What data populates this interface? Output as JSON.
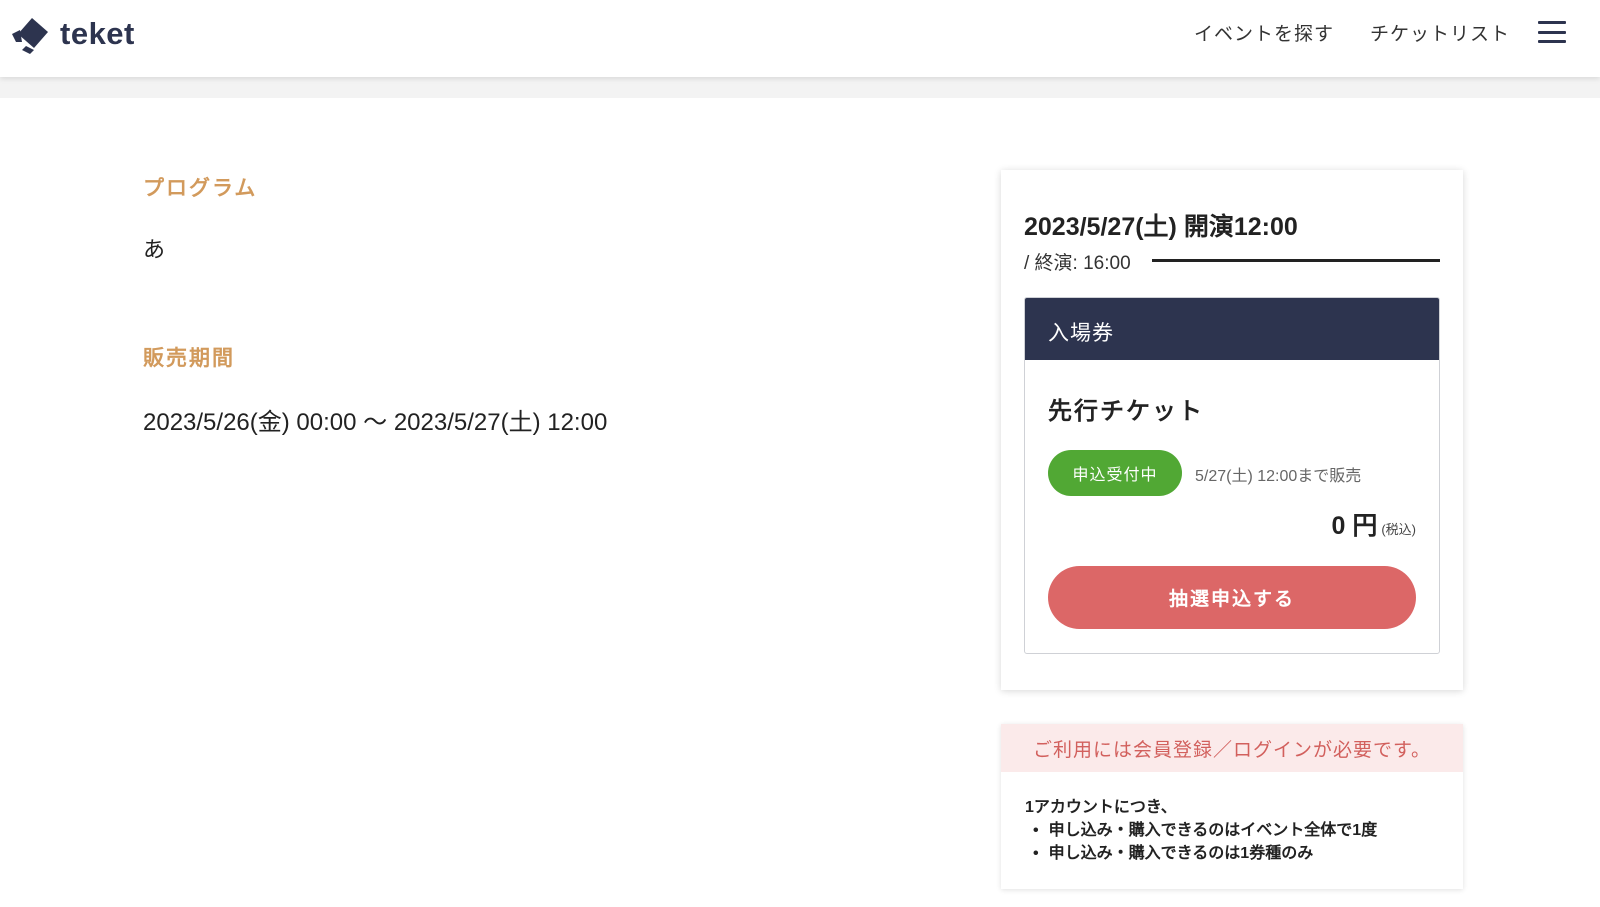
{
  "header": {
    "brand": "teket",
    "nav": [
      "イベントを探す",
      "チケットリスト"
    ]
  },
  "program": {
    "title": "プログラム",
    "body": "あ"
  },
  "sales_period": {
    "title": "販売期間",
    "value": "2023/5/26(金) 00:00 〜 2023/5/27(土) 12:00"
  },
  "performance": {
    "date": "2023/5/27(土) 開演12:00",
    "end": "/ 終演: 16:00"
  },
  "ticket": {
    "category": "入場券",
    "name": "先行チケット",
    "status": "申込受付中",
    "sale_until": "5/27(土) 12:00まで販売",
    "price": "0 円",
    "tax": "(税込)",
    "button": "抽選申込する"
  },
  "notice": {
    "header": "ご利用には会員登録／ログインが必要です。",
    "intro": "1アカウントにつき、",
    "items": [
      "申し込み・購入できるのはイベント全体で1度",
      "申し込み・購入できるのは1券種のみ"
    ]
  },
  "colors": {
    "brand_navy": "#2d344f",
    "section_title": "#d29a5c",
    "status_green": "#51a834",
    "button_red": "#dc6767",
    "notice_bg": "#fbeaea",
    "notice_text": "#d2605d"
  },
  "icons": [
    "ticket-logo-icon",
    "hamburger-menu-icon"
  ]
}
